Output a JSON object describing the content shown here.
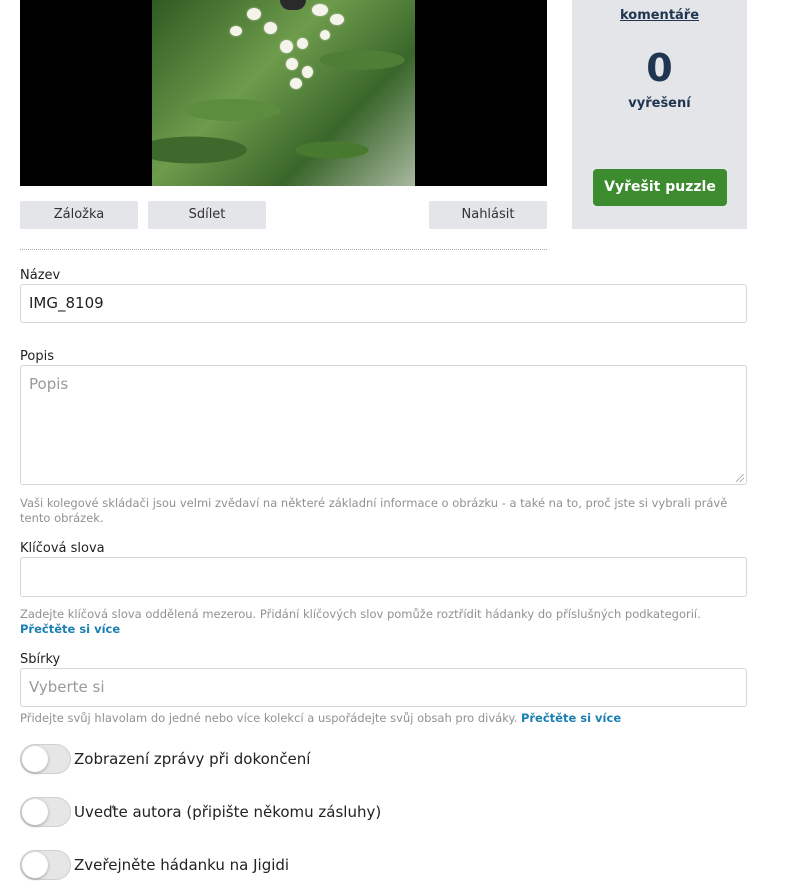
{
  "actions": {
    "bookmark": "Záložka",
    "share": "Sdílet",
    "report": "Nahlásit"
  },
  "stats": {
    "comments_link": "komentáře",
    "solved_count": "0",
    "solved_label": "vyřešení",
    "solve_button": "Vyřešit puzzle"
  },
  "form": {
    "name": {
      "label": "Název",
      "value": "IMG_8109"
    },
    "description": {
      "label": "Popis",
      "placeholder": "Popis",
      "help": "Vaši kolegové skládači jsou velmi zvědaví na některé základní informace o obrázku - a také na to, proč jste si vybrali právě tento obrázek."
    },
    "keywords": {
      "label": "Klíčová slova",
      "value": "",
      "help": "Zadejte klíčová slova oddělená mezerou. Přidání klíčových slov pomůže roztřídit hádanky do příslušných podkategorií.",
      "link": "Přečtěte si více"
    },
    "collections": {
      "label": "Sbírky",
      "placeholder": "Vyberte si",
      "help": "Přidejte svůj hlavolam do jedné nebo více kolekcí a uspořádejte svůj obsah pro diváky.",
      "link": "Přečtěte si více"
    }
  },
  "toggles": [
    {
      "label": "Zobrazení zprávy při dokončení",
      "on": false
    },
    {
      "label": "Uveďte autora (připište někomu zásluhy)",
      "on": false
    },
    {
      "label": "Zveřejněte hádanku na Jigidi",
      "on": false
    }
  ],
  "colors": {
    "accent_green": "#3d8b2f",
    "link_blue": "#1b7fb3",
    "panel_gray": "#e3e5e8"
  }
}
